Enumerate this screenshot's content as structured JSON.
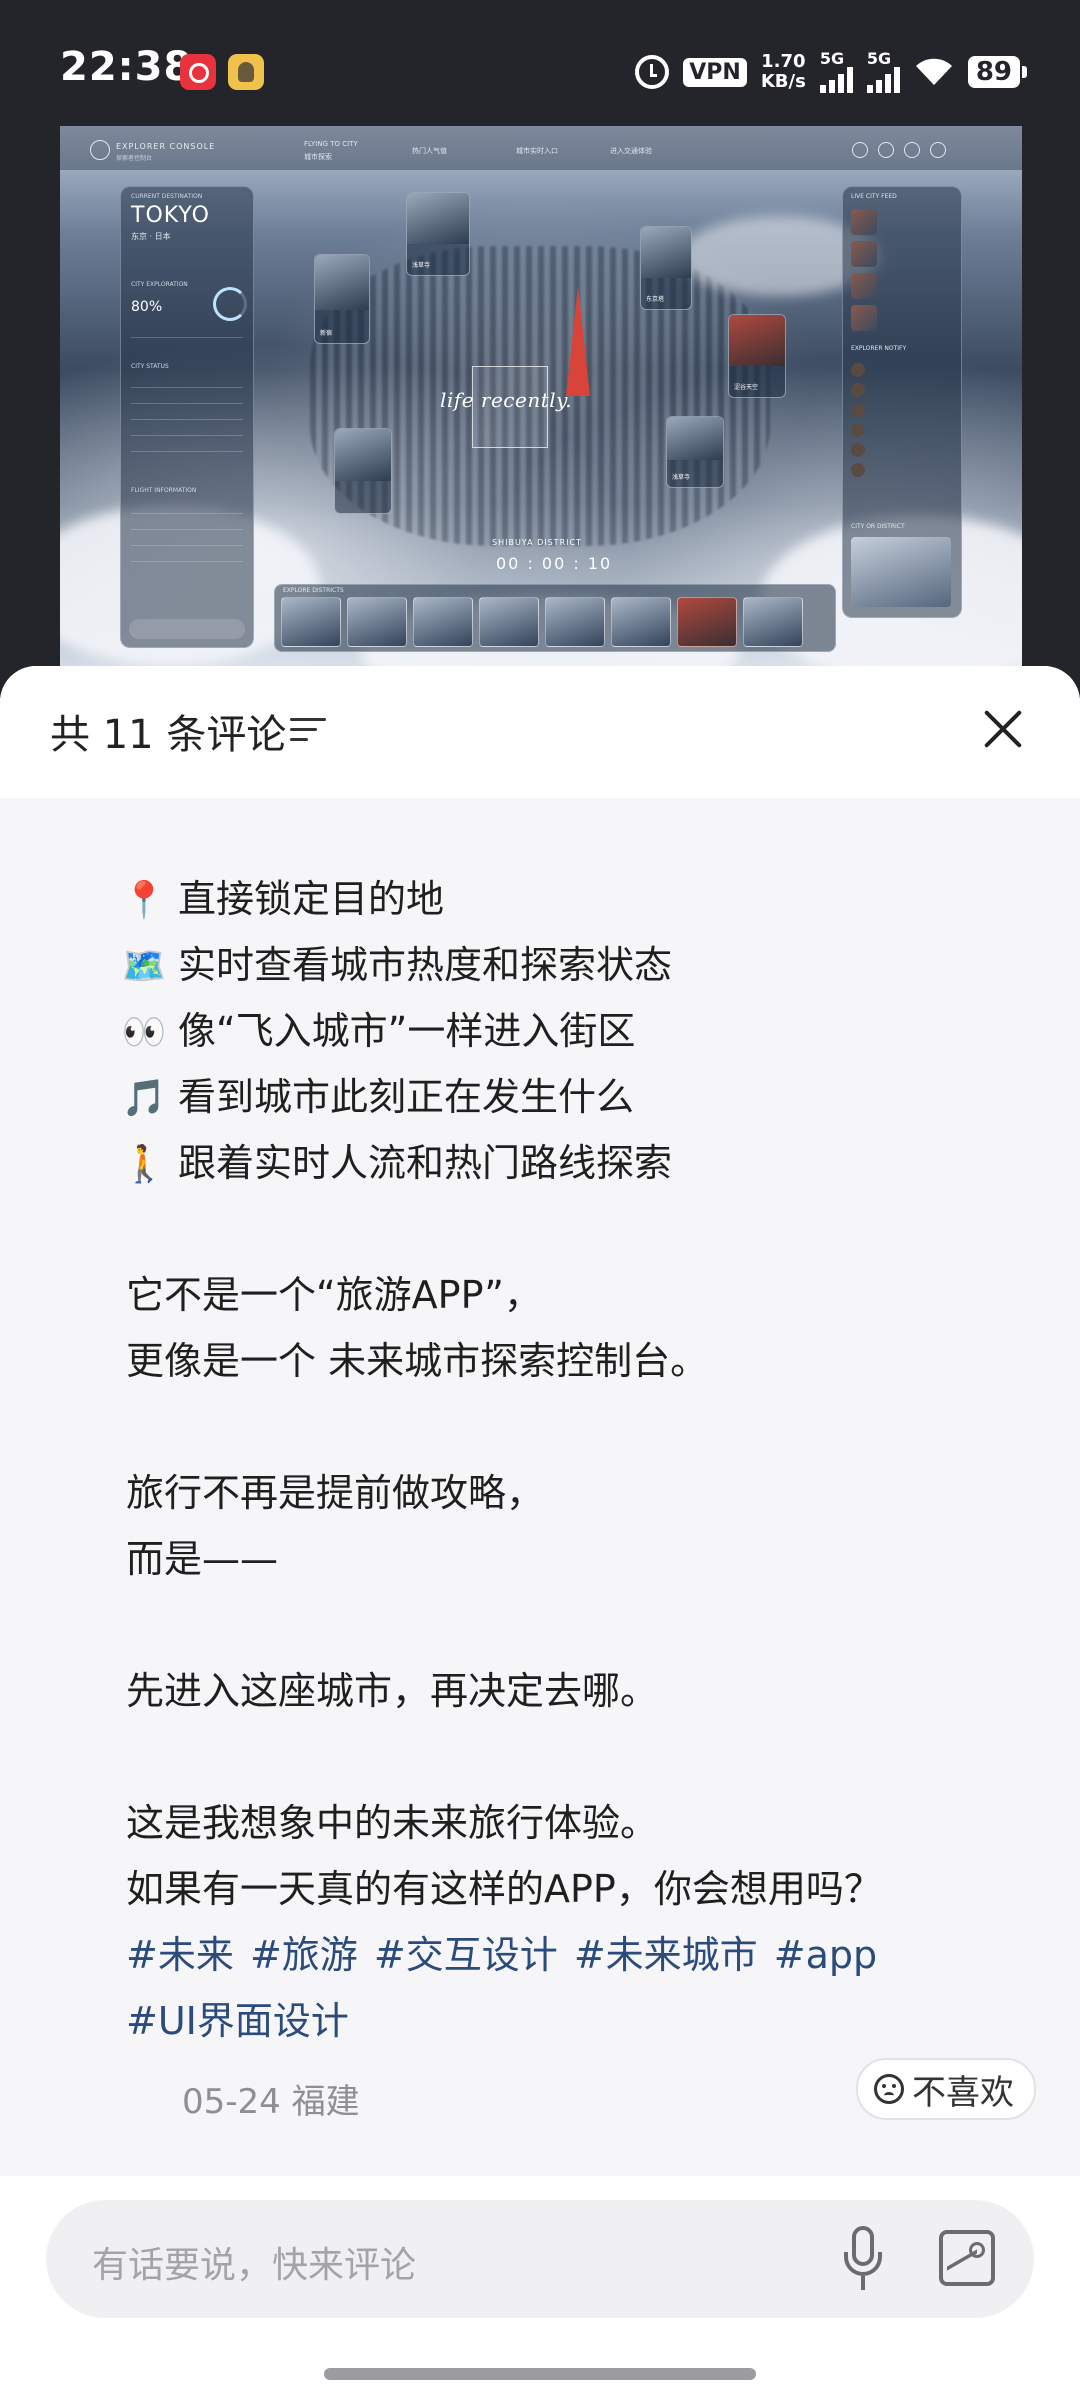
{
  "status_bar": {
    "time": "22:38",
    "vpn": "VPN",
    "net_speed_value": "1.70",
    "net_speed_unit": "KB/s",
    "signal1_label": "5G",
    "signal2_label": "5G",
    "battery": "89",
    "icons": [
      "weibo-icon",
      "app-notification-icon",
      "alarm-icon",
      "signal-icon",
      "wifi-icon",
      "battery-icon"
    ]
  },
  "post_image": {
    "brand": "EXPLORER CONSOLE",
    "brand_sub": "探索者控制台",
    "nav": [
      "FLYING TO CITY",
      "城市探索",
      "热门人气值",
      "城市实时入口",
      "进入交通体验"
    ],
    "city": "TOKYO",
    "city_sub": "东京 · 日本",
    "explore_pct": "80%",
    "left_panel_labels": [
      "CURRENT DESTINATION",
      "CITY EXPLORATION",
      "CITY STATUS",
      "FLIGHT INFORMATION"
    ],
    "right_panel_title": "LIVE CITY FEED",
    "right_panel_title2": "EXPLORER NOTIFY",
    "right_panel_title3": "CITY OR DISTRICT",
    "center_title": "life recently.",
    "district": "SHIBUYA DISTRICT",
    "timer": "00 : 00 : 10",
    "strip_label": "EXPLORE DISTRICTS",
    "card_captions": [
      "浅草寺",
      "东京塔",
      "新宿",
      "涩谷天空",
      "浅草寺"
    ]
  },
  "sheet": {
    "comment_count": "共 11 条评论",
    "lines": [
      {
        "emoji": "📍",
        "text": "直接锁定目的地"
      },
      {
        "emoji": "🗺️",
        "text": "实时查看城市热度和探索状态"
      },
      {
        "emoji": "👀",
        "text": "像“飞入城市”一样进入街区"
      },
      {
        "emoji": "🎵",
        "text": "看到城市此刻正在发生什么"
      },
      {
        "emoji": "🚶",
        "text": "跟着实时人流和热门路线探索"
      }
    ],
    "para1": [
      "它不是一个“旅游APP”，",
      "更像是一个 未来城市探索控制台。"
    ],
    "para2": [
      "旅行不再是提前做攻略，",
      "而是——"
    ],
    "para3": "先进入这座城市，再决定去哪。",
    "para4": [
      "这是我想象中的未来旅行体验。",
      "如果有一天真的有这样的APP，你会想用吗？"
    ],
    "hashtags": [
      "#未来",
      "#旅游",
      "#交互设计",
      "#未来城市",
      "#app",
      "#UI界面设计"
    ],
    "meta": "05-24 福建",
    "dislike": "不喜欢",
    "input_placeholder": "有话要说，快来评论"
  }
}
